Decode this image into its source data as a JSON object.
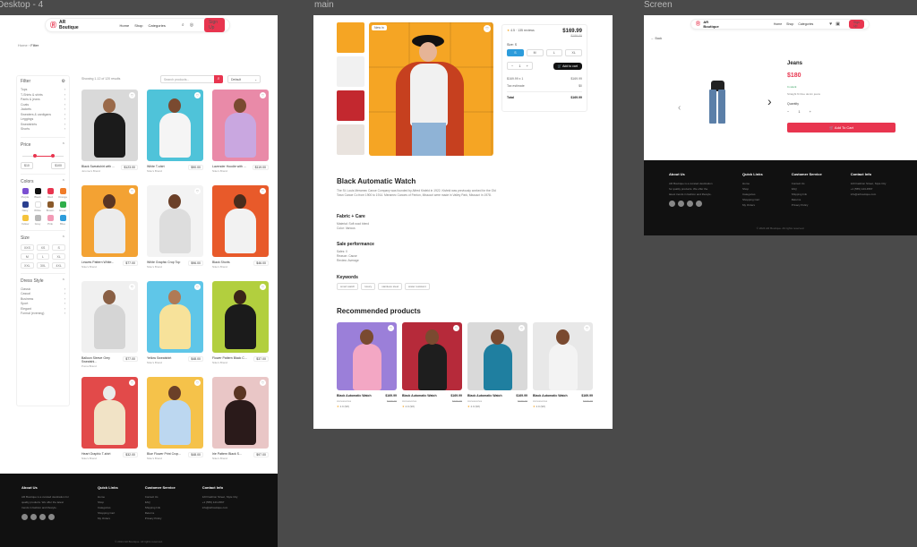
{
  "frames": {
    "f1_label": "Desktop - 4",
    "f2_label": "main",
    "f3_label": "Screen"
  },
  "nav": {
    "brand": "AR Boutique",
    "links": [
      "Home",
      "Shop",
      "Categories"
    ],
    "signup": "Sign Up"
  },
  "shop": {
    "breadcrumb_home": "Home",
    "breadcrumb_current": "Filter",
    "filters_title": "Filter",
    "categories": [
      "Tops",
      "T-Shirts & shirts",
      "Pants & jeans",
      "Coats",
      "Jackets",
      "Sweaters & cardigans",
      "Leggings",
      "Sweatshirts",
      "Shorts"
    ],
    "price_title": "Price",
    "price_min": "$10",
    "price_max": "$100",
    "colors_title": "Colors",
    "colors": [
      {
        "name": "Purple",
        "hex": "#7b4fd1"
      },
      {
        "name": "Black",
        "hex": "#111111"
      },
      {
        "name": "Red",
        "hex": "#e8354f"
      },
      {
        "name": "Orange",
        "hex": "#f07c2a"
      },
      {
        "name": "Navy",
        "hex": "#2a3f8f"
      },
      {
        "name": "White",
        "hex": "#ffffff"
      },
      {
        "name": "Brown",
        "hex": "#8a5a2b"
      },
      {
        "name": "Green",
        "hex": "#2fae4a"
      },
      {
        "name": "Yellow",
        "hex": "#f5c33b"
      },
      {
        "name": "Grey",
        "hex": "#b8b8b8"
      },
      {
        "name": "Pink",
        "hex": "#f29ab5"
      },
      {
        "name": "Blue",
        "hex": "#2d9cdb"
      }
    ],
    "size_title": "Size",
    "sizes": [
      "XXS",
      "XS",
      "S",
      "M",
      "L",
      "XL",
      "XXL",
      "3XL",
      "4XL"
    ],
    "dress_title": "Dress Style",
    "dress_styles": [
      "Classic",
      "Casual",
      "Business",
      "Sport",
      "Elegant",
      "Formal (evening)"
    ],
    "result_count": "Showing 1-12 of 120 results",
    "search_placeholder": "Search products...",
    "sort_label": "Default",
    "products": [
      {
        "name": "Black Sweatshirt with ...",
        "brand": "Jerome's Brand",
        "price": "$123.00",
        "bg": "#d9d9d9",
        "body": "#1b1b1b",
        "head": "#9a6a4a"
      },
      {
        "name": "White T-shirt",
        "brand": "Nike's Brand",
        "price": "$90.00",
        "bg": "#4fc3d9",
        "body": "#f5f5f5",
        "head": "#7a4a30"
      },
      {
        "name": "Lavender Hoodie with ...",
        "brand": "Nike's Brand",
        "price": "$119.00",
        "bg": "#e98aa8",
        "body": "#c9a7e0",
        "head": "#7a4a30"
      },
      {
        "name": "Leaves Pattern White...",
        "brand": "Nike's Brand",
        "price": "$77.00",
        "bg": "#f3a233",
        "body": "#ececec",
        "head": "#5a3523"
      },
      {
        "name": "White Graphic Crop Top",
        "brand": "Nike's Brand",
        "price": "$96.00",
        "bg": "#f3f3f3",
        "body": "#dddddd",
        "head": "#6b4028"
      },
      {
        "name": "Black Shorts",
        "brand": "Nike's Brand",
        "price": "$46.00",
        "bg": "#e85a2a",
        "body": "#f2f2f2",
        "head": "#4a2c1c"
      },
      {
        "name": "Balloon Sleeve Grey Sweatshi...",
        "brand": "Puma Brand",
        "price": "$77.00",
        "bg": "#f0f0f0",
        "body": "#d5d5d5",
        "head": "#8a6045"
      },
      {
        "name": "Yellow Sweatshirt",
        "brand": "Nike's Brand",
        "price": "$48.00",
        "bg": "#5fc6e8",
        "body": "#f7e29a",
        "head": "#b07a55"
      },
      {
        "name": "Flower Pattern Black C...",
        "brand": "Nike's Brand",
        "price": "$37.00",
        "bg": "#b2cf3e",
        "body": "#1b1b1b",
        "head": "#3a2418"
      },
      {
        "name": "Heart Graphic T-shirt",
        "brand": "Nike's Brand",
        "price": "$32.00",
        "bg": "#e24a4a",
        "body": "#f1e3c6",
        "head": "#eaeaea"
      },
      {
        "name": "Blue Flower Print Crop...",
        "brand": "Nike's Brand",
        "price": "$48.00",
        "bg": "#f5c24a",
        "body": "#bcd7f0",
        "head": "#6b4028"
      },
      {
        "name": "Irie Pattern Black S...",
        "brand": "Nike's Brand",
        "price": "$97.00",
        "bg": "#e9c6c6",
        "body": "#2a1a1a",
        "head": "#5a3523"
      }
    ]
  },
  "footer": {
    "about_title": "About Us",
    "about_text": "AR Boutique is a curated destination for quality products. We offer the latest trends in fashion and lifestyle.",
    "quick_title": "Quick Links",
    "quick_links": [
      "Home",
      "Shop",
      "Categories",
      "Shopping Cart",
      "My Orders"
    ],
    "service_title": "Customer Service",
    "service_links": [
      "Contact Us",
      "FAQ",
      "Shipping Info",
      "Returns",
      "Privacy Policy"
    ],
    "contact_title": "Contact Info",
    "contact_lines": [
      "123 Fashion Street, Style City",
      "+1 (555) 123-4567",
      "info@arboutique.com"
    ],
    "copyright": "© 2024 AR Boutique. All rights reserved."
  },
  "detail": {
    "tag": "New in",
    "rating": "4.5",
    "reviews": "135 reviews",
    "price": "$169.99",
    "old_price": "$189.00",
    "size_label": "Size: S",
    "sizes": [
      "S",
      "M",
      "L",
      "XL"
    ],
    "selected_size": "S",
    "qty": "1",
    "add_to_cart": "Add to cart",
    "summary": [
      {
        "label": "$169.99 x 1",
        "value": "$169.99"
      },
      {
        "label": "Tax estimate",
        "value": "$0"
      }
    ],
    "total_label": "Total",
    "total_value": "$169.99",
    "title": "Black Automatic Watch",
    "description": "The St. Louis Meramec Canoe Company was founded by Alfred Kisfeld in 1922. Kisfeld was previously worked for the Old Town Canoe Co from 1900 to 1914. Meramec Canoes of Fenton, Missouri were made in Valley Park, Missouri in 1978.",
    "fabric_title": "Fabric + Care",
    "fabric_lines": [
      "Material: Soft wool blend",
      "Color: Various"
    ],
    "sale_title": "Sale performance",
    "sale_lines": [
      "Sales: 0",
      "Reason: Cause",
      "Review: Average"
    ],
    "keywords_title": "Keywords",
    "keywords": [
      "smart watch",
      "luxury",
      "stainless steel",
      "water resistant"
    ],
    "rec_title": "Recommended products",
    "rec": [
      {
        "name": "Black Automatic Watch",
        "price": "$169.99",
        "cat": "Accessories",
        "old": "$199.99",
        "rating": "4.9 (98)",
        "bg": "#9b7fd9",
        "body": "#f3a7c4"
      },
      {
        "name": "Black Automatic Watch",
        "price": "$169.99",
        "cat": "Accessories",
        "old": "$199.99",
        "rating": "4.9 (98)",
        "bg": "#b62a3a",
        "body": "#1e1e1e"
      },
      {
        "name": "Black Automatic Watch",
        "price": "$169.99",
        "cat": "Accessories",
        "old": "$199.99",
        "rating": "4.9 (98)",
        "bg": "#d9d9d9",
        "body": "#1f7fa0"
      },
      {
        "name": "Black Automatic Watch",
        "price": "$169.99",
        "cat": "Accessories",
        "old": "$199.99",
        "rating": "4.9 (98)",
        "bg": "#e8e8e8",
        "body": "#f3f3f3"
      }
    ]
  },
  "small": {
    "back": "Back",
    "name": "Jeans",
    "price": "$180",
    "stock": "In stock",
    "desc": "Straight fit blue denim jeans",
    "qty_label": "Quantity",
    "qty": "1",
    "add": "Add To Cart"
  }
}
